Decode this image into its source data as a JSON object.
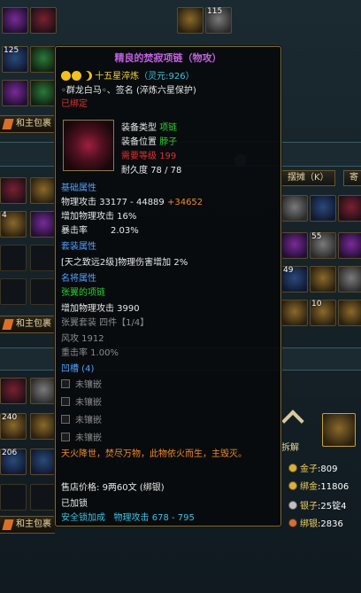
{
  "background": {
    "top_slot_counts": [
      "115",
      "125"
    ],
    "sidebar_buttons": [
      "和主包裹",
      "和主包裹",
      "和主包裹"
    ],
    "right_tabs": [
      "摆摊（K）",
      "寄"
    ],
    "grid_counts": [
      "4",
      "55",
      "49",
      "10",
      "240",
      "206"
    ],
    "split_label": "拆解",
    "currency": [
      {
        "label": "金子",
        "value": ":809"
      },
      {
        "label": "绑金",
        "value": ":11806"
      },
      {
        "label": "银子",
        "value": ":25锭4"
      },
      {
        "label": "绑银",
        "value": ":2836"
      }
    ]
  },
  "tooltip": {
    "title": "精良的焚寂项链（物攻）",
    "star_line": "十五星淬炼",
    "spirit": "（灵元:926）",
    "engraving": "◦群龙白马◦、签名 (淬炼六星保护)",
    "bound": "已绑定",
    "equip_type_label": "装备类型",
    "equip_type_value": "项链",
    "equip_pos_label": "装备位置",
    "equip_pos_value": "脖子",
    "req_level_label": "需要等级",
    "req_level_value": "199",
    "durability_label": "耐久度",
    "durability_value": "78 / 78",
    "base_header": "基础属性",
    "attr1_label": "物理攻击",
    "attr1_value": "33177 - 44889",
    "attr1_bonus": "+34652",
    "attr2": "增加物理攻击 16%",
    "attr3_label": "暴击率",
    "attr3_value": "2.03%",
    "set_header": "套装属性",
    "set_attr": "[天之致远2级]物理伤害增加 2%",
    "famous_header": "名将属性",
    "famous_name": "张翼的项链",
    "famous_attr": "增加物理攻击 3990",
    "famous_set": "张翼套装 四件【1/4】",
    "famous_sub1": "风攻 1912",
    "famous_sub2": "重击率 1.00%",
    "slots_header": "凹槽 (4)",
    "slots": [
      "未镶嵌",
      "未镶嵌",
      "未镶嵌",
      "未镶嵌"
    ],
    "flavor": "天火降世，焚尽万物，此物依火而生，主毁灭。",
    "price_label": "售店价格:",
    "price_value": "9两60文",
    "price_note": "(绑银)",
    "locked": "已加锁",
    "lock_bonus_label": "安全锁加成",
    "lock_bonus_attr": "物理攻击",
    "lock_bonus_value": "678 - 795"
  }
}
